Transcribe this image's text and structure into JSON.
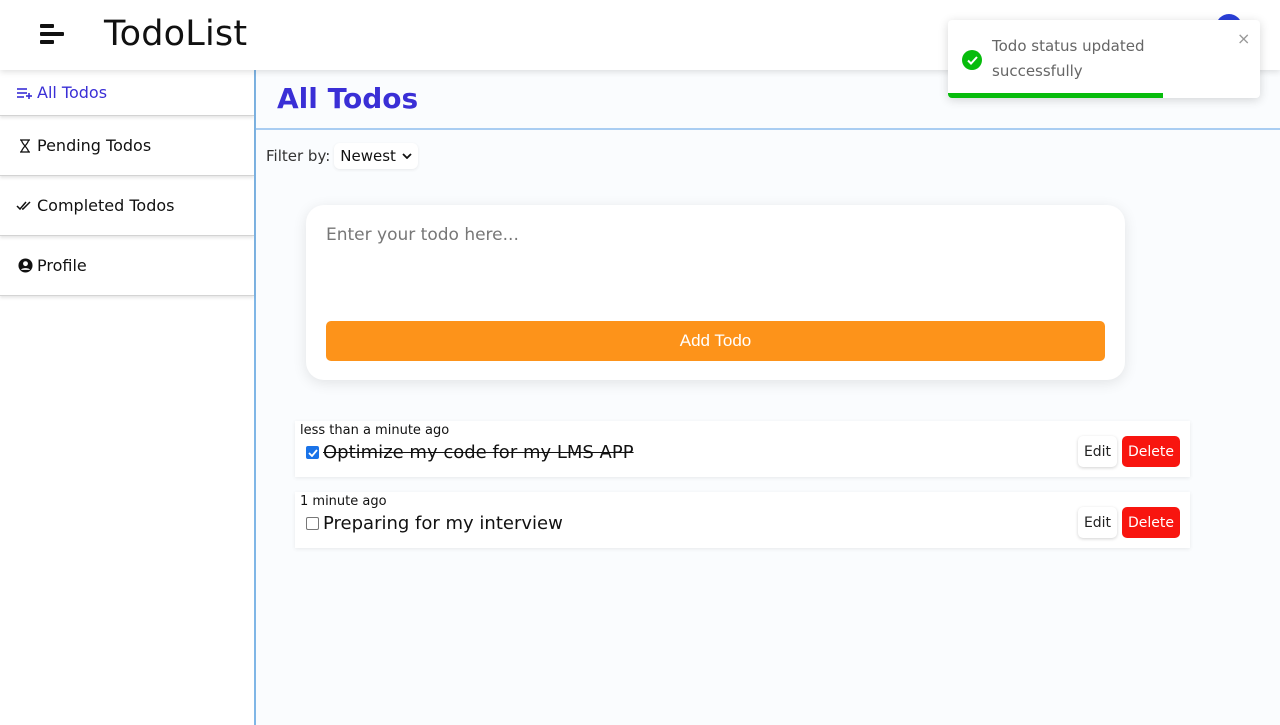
{
  "header": {
    "title": "TodoList"
  },
  "sidebar": {
    "items": [
      {
        "label": "All Todos",
        "icon": "add-list-icon",
        "active": true
      },
      {
        "label": "Pending Todos",
        "icon": "hourglass-icon"
      },
      {
        "label": "Completed Todos",
        "icon": "double-check-icon"
      },
      {
        "label": "Profile",
        "icon": "user-circle-icon"
      }
    ]
  },
  "main": {
    "title": "All Todos",
    "filter": {
      "label": "Filter by:",
      "selected": "Newest"
    },
    "input": {
      "placeholder": "Enter your todo here..."
    },
    "add_button": "Add Todo",
    "todos": [
      {
        "time": "less than a minute ago",
        "text": "Optimize my code for my LMS APP",
        "completed": true,
        "edit": "Edit",
        "delete": "Delete"
      },
      {
        "time": "1 minute ago",
        "text": "Preparing for my interview",
        "completed": false,
        "edit": "Edit",
        "delete": "Delete"
      }
    ]
  },
  "toast": {
    "message": "Todo status updated successfully",
    "close": "×",
    "progress": 0.69
  },
  "colors": {
    "accent": "#3a2fd6",
    "add_button": "#fd931a",
    "delete": "#f8150f",
    "success": "#07bc0c"
  }
}
